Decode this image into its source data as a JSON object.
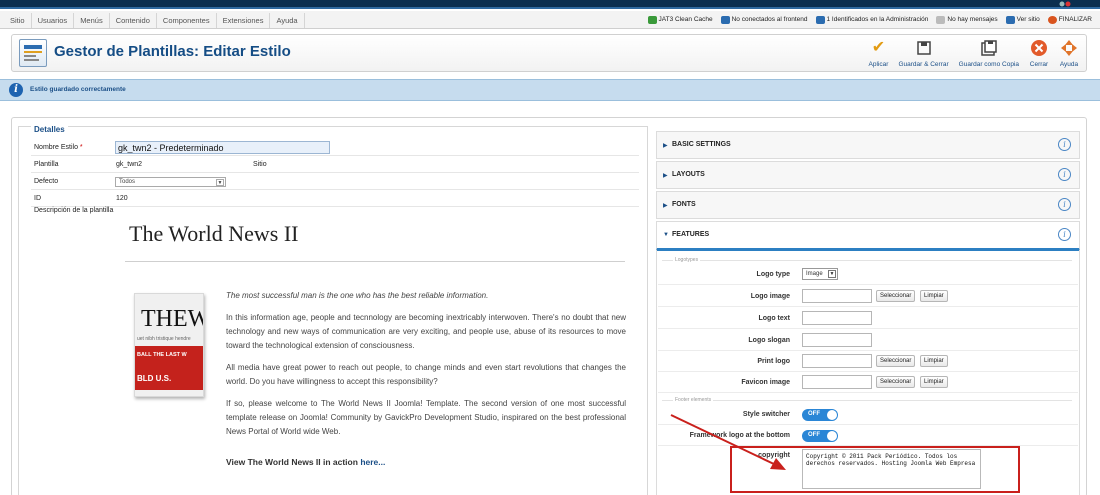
{
  "menu": [
    "Sitio",
    "Usuarios",
    "Menús",
    "Contenido",
    "Componentes",
    "Extensiones",
    "Ayuda"
  ],
  "status": [
    {
      "label": "JAT3 Clean Cache",
      "icon": "broom-icon",
      "color": "#3a9a3a"
    },
    {
      "label": "No conectados al frontend",
      "icon": "users-icon",
      "color": "#2b6cb0"
    },
    {
      "label": "1 Identificados en la Administración",
      "icon": "users-icon",
      "color": "#2b6cb0"
    },
    {
      "label": "No hay mensajes",
      "icon": "mail-icon",
      "color": "#888888"
    },
    {
      "label": "Ver sitio",
      "icon": "monitor-icon",
      "color": "#2b6cb0"
    },
    {
      "label": "FINALIZAR",
      "icon": "power-icon",
      "color": "#d9541e"
    }
  ],
  "toolbar": {
    "title": "Gestor de Plantillas: Editar Estilo",
    "buttons": [
      {
        "label": "Aplicar",
        "icon": "check-icon",
        "glyph": "✔",
        "color": "#e29b12"
      },
      {
        "label": "Guardar & Cerrar",
        "icon": "save-close-icon",
        "glyph": "▣",
        "color": "#444444"
      },
      {
        "label": "Guardar como Copia",
        "icon": "save-copy-icon",
        "glyph": "▣",
        "color": "#444444"
      },
      {
        "label": "Cerrar",
        "icon": "close-icon",
        "glyph": "✖",
        "color": "#e25a2a"
      },
      {
        "label": "Ayuda",
        "icon": "help-arrows-icon",
        "glyph": "✥",
        "color": "#e0742a"
      }
    ]
  },
  "message": "Estilo guardado correctamente",
  "details": {
    "legend": "Detalles",
    "name_label": "Nombre Estilo",
    "name_required": "*",
    "name_value": "gk_twn2 - Predeterminado",
    "plantilla_label": "Plantilla",
    "plantilla_value": "gk_twn2",
    "plantilla_client": "Sitio",
    "defecto_label": "Defecto",
    "defecto_value": "Todos",
    "id_label": "ID",
    "id_value": "120",
    "desc_label": "Descripción de la plantilla"
  },
  "article": {
    "title": "The World News II",
    "thumb_big": "THEW",
    "thumb_small": "uet nibh tristique hendre",
    "thumb_red_a": "BALL   THE LAST W",
    "thumb_red_b": "BLD    U.S.",
    "p1": "The most successful man is the one who has the best reliable information.",
    "p2": "In this information age, people and tecnnology are becoming inextricably interwoven. There's no doubt that new technology and new ways of communication are very exciting, and people use, abuse of its resources to move toward the technological extension of consciousness.",
    "p3": "All media have great power to reach out people, to change minds and even start revolutions that changes the world. Do you have willingness to accept this responsibility?",
    "p4": "If so, please welcome to The World News II Joomla! Template. The second version of one most successful template release on Joomla! Community by GavickPro Development Studio, inspirared on the best professional News Portal of World wide Web.",
    "view_text": "View The World News II in action",
    "view_link": "here..."
  },
  "accordion": [
    {
      "title": "BASIC SETTINGS",
      "open": false
    },
    {
      "title": "LAYOUTS",
      "open": false
    },
    {
      "title": "FONTS",
      "open": false
    },
    {
      "title": "FEATURES",
      "open": true
    }
  ],
  "features": {
    "group_logotypes": "Logotypes",
    "group_footer": "Footer elements",
    "logo_type_label": "Logo type",
    "logo_type_value": "Image",
    "logo_image_label": "Logo image",
    "logo_text_label": "Logo text",
    "logo_slogan_label": "Logo slogan",
    "print_logo_label": "Print logo",
    "favicon_label": "Favicon image",
    "select_btn": "Seleccionar",
    "clear_btn": "Limpiar",
    "style_switcher_label": "Style switcher",
    "framework_logo_label": "Framework logo at the bottom",
    "toggle_off": "OFF",
    "copyright_label": "copyright",
    "copyright_value": "Copyright © 2011 Pack Periódico. Todos los derechos reservados. Hosting Joomla Web Empresa"
  },
  "colors": {
    "accent": "#1b4f87",
    "highlight": "#c9201c",
    "toggle": "#2a86d6"
  }
}
